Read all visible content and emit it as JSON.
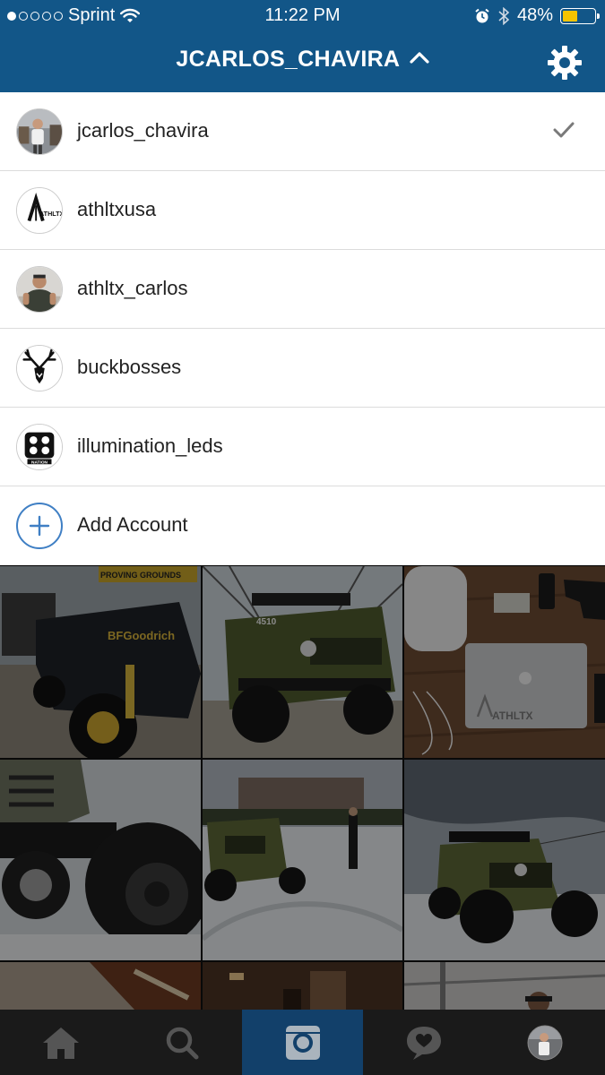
{
  "status_bar": {
    "carrier": "Sprint",
    "time": "11:22 PM",
    "battery_percent": "48%",
    "battery_level": 0.48,
    "signal_strength": 1,
    "signal_dots": 5
  },
  "header": {
    "title": "JCARLOS_CHAVIRA",
    "caret_icon": "chevron-up-icon",
    "settings_icon": "gear-icon"
  },
  "accounts": [
    {
      "username": "jcarlos_chavira",
      "selected": true
    },
    {
      "username": "athltxusa",
      "selected": false
    },
    {
      "username": "athltx_carlos",
      "selected": false
    },
    {
      "username": "buckbosses",
      "selected": false
    },
    {
      "username": "illumination_leds",
      "selected": false
    }
  ],
  "add_account_label": "Add Account",
  "avatar_texts": {
    "athltx": "ATHLTX",
    "nation": "NATION"
  },
  "photos": {
    "tile1_text": "BFGoodrich",
    "tile1_sign": "PROVING GROUNDS",
    "tile2_text": "4510",
    "tile3_brand": "ATHLTX"
  },
  "tab_bar": {
    "items": [
      "home-icon",
      "search-icon",
      "camera-icon",
      "activity-icon",
      "profile-icon"
    ],
    "active": "camera-icon"
  },
  "colors": {
    "header_bg": "#125688",
    "accent": "#3f7fc4",
    "tab_active_bg": "#12406a",
    "battery": "#f5c400"
  }
}
